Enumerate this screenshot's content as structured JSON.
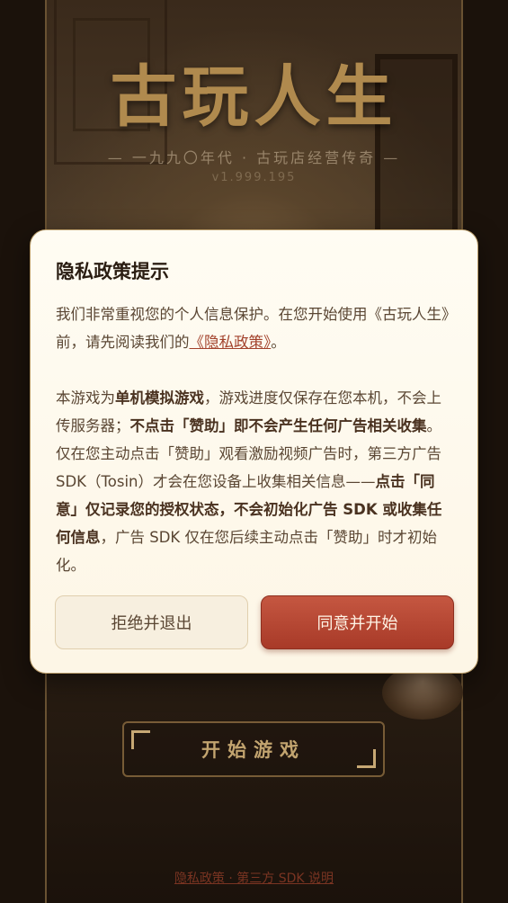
{
  "background": {
    "title": "古玩人生",
    "subtitle": "— 一九九〇年代 · 古玩店经营传奇 —",
    "version": "v1.999.195",
    "start_button": "开始游戏",
    "footer_links": "隐私政策 · 第三方 SDK 说明"
  },
  "modal": {
    "title": "隐私政策提示",
    "p1_pre": "我们非常重视您的个人信息保护。在您开始使用《古玩人生》前，请先阅读我们的",
    "p1_link": "《隐私政策》",
    "p1_post": "。",
    "p2_a": "本游戏为",
    "p2_b": "单机模拟游戏",
    "p2_c": "，游戏进度仅保存在您本机，不会上传服务器；",
    "p2_d": "不点击「赞助」即不会产生任何广告相关收集",
    "p2_e": "。仅在您主动点击「赞助」观看激励视频广告时，第三方广告 SDK（Tosin）才会在您设备上收集相关信息——",
    "p2_f": "点击「同意」仅记录您的授权状态，不会初始化广告 SDK 或收集任何信息",
    "p2_g": "，广告 SDK 仅在您后续主动点击「赞助」时才初始化。",
    "reject_label": "拒绝并退出",
    "accept_label": "同意并开始"
  },
  "colors": {
    "accent": "#b4442f",
    "gold": "#b08a4e",
    "modal_bg": "#fdf7ea"
  }
}
